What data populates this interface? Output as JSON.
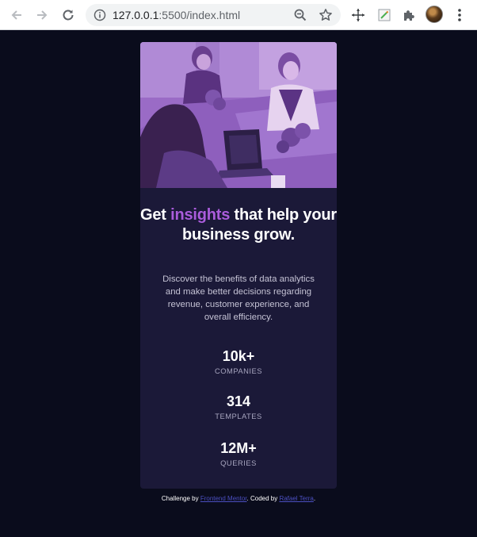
{
  "browser": {
    "url_host": "127.0.0.1",
    "url_path": ":5500/index.html",
    "icons": [
      "back-arrow-icon",
      "forward-arrow-icon",
      "reload-icon",
      "info-icon",
      "zoom-out-icon",
      "star-icon",
      "crosshair-extension-icon",
      "notepad-extension-icon",
      "puzzle-extensions-icon",
      "profile-avatar",
      "kebab-menu-icon"
    ]
  },
  "card": {
    "headline_pre": "Get ",
    "headline_accent": "insights",
    "headline_post": " that help your business grow.",
    "description": "Discover the benefits of data analytics and make better decisions regarding revenue, customer experience, and overall efficiency.",
    "stats": [
      {
        "value": "10k+",
        "label": "COMPANIES"
      },
      {
        "value": "314",
        "label": "TEMPLATES"
      },
      {
        "value": "12M+",
        "label": "QUERIES"
      }
    ]
  },
  "attribution": {
    "prefix": "Challenge by ",
    "link1": "Frontend Mentor",
    "middle": ". Coded by ",
    "link2": "Rafael Terra",
    "suffix": "."
  },
  "colors": {
    "page_bg": "#0a0c1c",
    "card_bg": "#1b1938",
    "accent": "#aa5cdb",
    "link": "#4b4fc0"
  }
}
